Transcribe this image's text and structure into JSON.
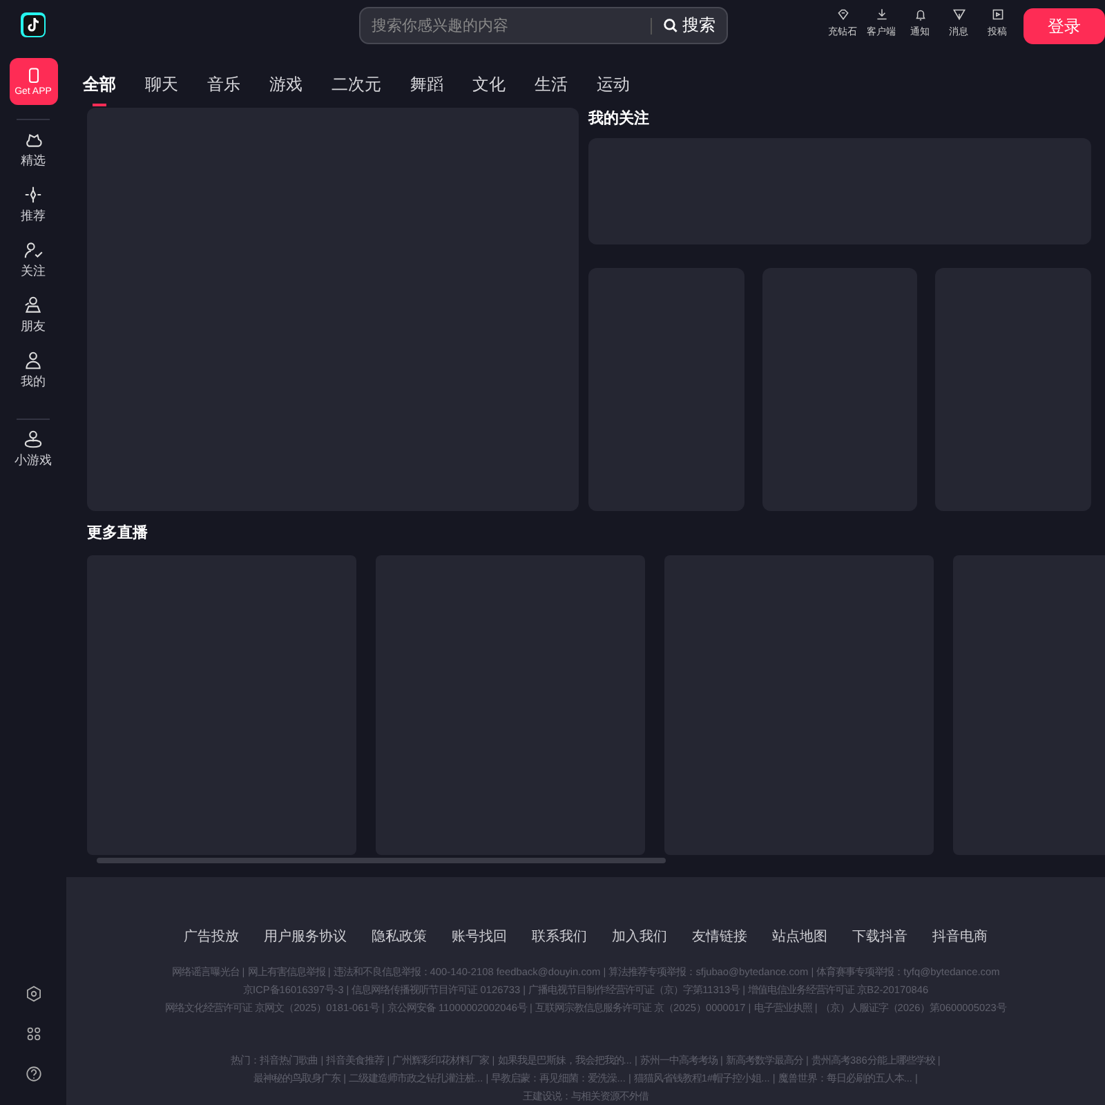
{
  "search": {
    "placeholder": "搜索你感兴趣的内容",
    "button": "搜索"
  },
  "top_actions": [
    {
      "label": "充钻石"
    },
    {
      "label": "客户端"
    },
    {
      "label": "通知"
    },
    {
      "label": "消息"
    },
    {
      "label": "投稿"
    }
  ],
  "login": "登录",
  "get_app": "Get APP",
  "sidebar": {
    "items": [
      {
        "label": "精选"
      },
      {
        "label": "推荐"
      },
      {
        "label": "关注"
      },
      {
        "label": "朋友"
      },
      {
        "label": "我的"
      }
    ],
    "extra_items": [
      {
        "label": "小游戏"
      }
    ]
  },
  "categories": [
    {
      "label": "全部",
      "selected": true
    },
    {
      "label": "聊天",
      "selected": false
    },
    {
      "label": "音乐",
      "selected": false
    },
    {
      "label": "游戏",
      "selected": false
    },
    {
      "label": "二次元",
      "selected": false
    },
    {
      "label": "舞蹈",
      "selected": false
    },
    {
      "label": "文化",
      "selected": false
    },
    {
      "label": "生活",
      "selected": false
    },
    {
      "label": "运动",
      "selected": false
    }
  ],
  "following_title": "我的关注",
  "more_live_title": "更多直播",
  "footer": {
    "links": [
      "广告投放",
      "用户服务协议",
      "隐私政策",
      "账号找回",
      "联系我们",
      "加入我们",
      "友情链接",
      "站点地图",
      "下载抖音",
      "抖音电商"
    ],
    "legal": [
      "网络谣言曝光台 | 网上有害信息举报 | 违法和不良信息举报：400-140-2108 feedback@douyin.com | 算法推荐专项举报：sfjubao@bytedance.com | 体育赛事专项举报：tyfq@bytedance.com",
      "京ICP备16016397号-3 | 信息网络传播视听节目许可证 0126733 | 广播电视节目制作经营许可证（京）字第11313号 | 增值电信业务经营许可证 京B2-20170846",
      "网络文化经营许可证 京网文（2025）0181-061号 | 京公网安备 11000002002046号 | 互联网宗教信息服务许可证 京（2025）0000017 | 电子营业执照 | （京）人服证字（2026）第0600005023号"
    ],
    "hot": [
      "热门：抖音热门歌曲 | 抖音美食推荐 | 广州辉彩印花材料厂家 | 如果我是巴斯妹，我会把我的... | 苏州一中高考考场 | 新高考数学最高分 | 贵州高考386分能上哪些学校 |",
      "最神秘的鸟取身广东 | 二级建造师市政之钻孔灌注桩... | 早教启蒙：再见细菌：爱洗澡... | 猫猫风省钱教程1#帽子控小姐... | 魔兽世界：每日必刷的五人本... |",
      "王建设说：与相关资源不外借"
    ]
  }
}
